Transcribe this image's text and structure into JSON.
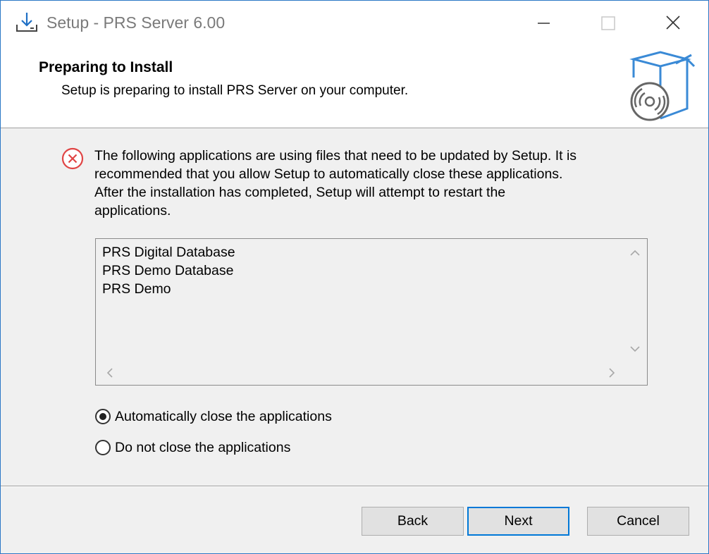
{
  "window": {
    "title": "Setup - PRS Server 6.00"
  },
  "header": {
    "title": "Preparing to Install",
    "subtitle": "Setup is preparing to install PRS Server on your computer."
  },
  "body": {
    "message": "The following applications are using files that need to be updated by Setup. It is\nrecommended that you allow Setup to automatically close these applications.\nAfter the installation has completed, Setup will attempt to restart the\napplications.",
    "applications": [
      "PRS Digital Database",
      "PRS Demo Database",
      "PRS Demo"
    ],
    "options": [
      {
        "label": "Automatically close the applications",
        "selected": true
      },
      {
        "label": "Do not close the applications",
        "selected": false
      }
    ]
  },
  "buttons": {
    "back": "Back",
    "next": "Next",
    "cancel": "Cancel"
  },
  "icons": {
    "app": "installer-download-icon",
    "minimize": "minimize-icon",
    "maximize": "maximize-icon",
    "close": "close-icon",
    "header_graphic": "box-disc-icon",
    "warning": "error-circle-x-icon"
  },
  "colors": {
    "window_border": "#2b78c6",
    "error_red": "#e04545",
    "default_button_border": "#0078d7"
  }
}
